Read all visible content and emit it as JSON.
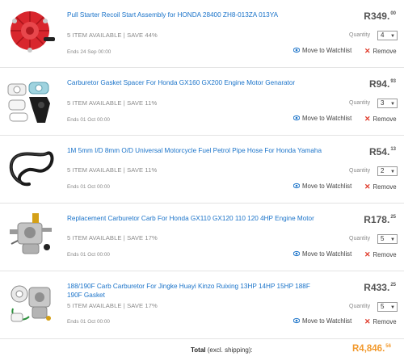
{
  "cart": {
    "items": [
      {
        "title": "Pull Starter Recoil Start Assembly for HONDA 28400 ZH8-013ZA 013YA",
        "availability": "5 ITEM AVAILABLE | SAVE 44%",
        "ends": "Ends 24 Sep 00:00",
        "price_main": "R349.",
        "price_cents": "00",
        "quantity_label": "Quantity",
        "quantity": "4",
        "watchlist_label": "Move to Watchlist",
        "remove_label": "Remove",
        "thumb_icon": "recoil-starter-icon"
      },
      {
        "title": "Carburetor Gasket Spacer For Honda GX160 GX200 Engine Motor Genarator",
        "availability": "5 ITEM AVAILABLE | SAVE 11%",
        "ends": "Ends 01 Oct 00:00",
        "price_main": "R94.",
        "price_cents": "93",
        "quantity_label": "Quantity",
        "quantity": "3",
        "watchlist_label": "Move to Watchlist",
        "remove_label": "Remove",
        "thumb_icon": "gasket-set-icon"
      },
      {
        "title": "1M 5mm I/D 8mm O/D Universal Motorcycle Fuel Petrol Pipe Hose For Honda Yamaha",
        "availability": "5 ITEM AVAILABLE | SAVE 11%",
        "ends": "Ends 01 Oct 00:00",
        "price_main": "R54.",
        "price_cents": "13",
        "quantity_label": "Quantity",
        "quantity": "2",
        "watchlist_label": "Move to Watchlist",
        "remove_label": "Remove",
        "thumb_icon": "fuel-hose-icon"
      },
      {
        "title": "Replacement Carburetor Carb For Honda GX110 GX120 110 120 4HP Engine Motor",
        "availability": "5 ITEM AVAILABLE | SAVE 17%",
        "ends": "Ends 01 Oct 00:00",
        "price_main": "R178.",
        "price_cents": "25",
        "quantity_label": "Quantity",
        "quantity": "5",
        "watchlist_label": "Move to Watchlist",
        "remove_label": "Remove",
        "thumb_icon": "carburetor-icon"
      },
      {
        "title": "188/190F Carb Carburetor For Jingke Huayi Kinzo Ruixing 13HP 14HP 15HP 188F 190F Gasket",
        "availability": "5 ITEM AVAILABLE | SAVE 17%",
        "ends": "Ends 01 Oct 00:00",
        "price_main": "R433.",
        "price_cents": "25",
        "quantity_label": "Quantity",
        "quantity": "5",
        "watchlist_label": "Move to Watchlist",
        "remove_label": "Remove",
        "thumb_icon": "carburetor-gasket-icon"
      }
    ],
    "total": {
      "label": "Total",
      "note": " (excl. shipping):",
      "value_main": "R4,846.",
      "value_cents": "56"
    }
  },
  "colors": {
    "link": "#1a73c9",
    "muted": "#8a8a8a",
    "remove_x": "#e03a2a",
    "total": "#f29a2e"
  }
}
